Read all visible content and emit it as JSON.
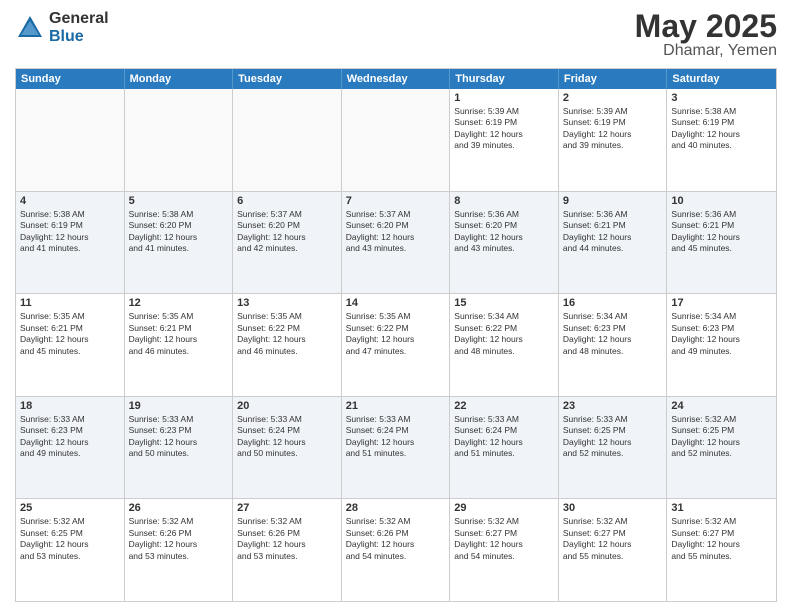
{
  "logo": {
    "general": "General",
    "blue": "Blue"
  },
  "title": "May 2025",
  "location": "Dhamar, Yemen",
  "weekdays": [
    "Sunday",
    "Monday",
    "Tuesday",
    "Wednesday",
    "Thursday",
    "Friday",
    "Saturday"
  ],
  "rows": [
    [
      {
        "day": "",
        "info": "",
        "empty": true
      },
      {
        "day": "",
        "info": "",
        "empty": true
      },
      {
        "day": "",
        "info": "",
        "empty": true
      },
      {
        "day": "",
        "info": "",
        "empty": true
      },
      {
        "day": "1",
        "info": "Sunrise: 5:39 AM\nSunset: 6:19 PM\nDaylight: 12 hours\nand 39 minutes."
      },
      {
        "day": "2",
        "info": "Sunrise: 5:39 AM\nSunset: 6:19 PM\nDaylight: 12 hours\nand 39 minutes."
      },
      {
        "day": "3",
        "info": "Sunrise: 5:38 AM\nSunset: 6:19 PM\nDaylight: 12 hours\nand 40 minutes."
      }
    ],
    [
      {
        "day": "4",
        "info": "Sunrise: 5:38 AM\nSunset: 6:19 PM\nDaylight: 12 hours\nand 41 minutes."
      },
      {
        "day": "5",
        "info": "Sunrise: 5:38 AM\nSunset: 6:20 PM\nDaylight: 12 hours\nand 41 minutes."
      },
      {
        "day": "6",
        "info": "Sunrise: 5:37 AM\nSunset: 6:20 PM\nDaylight: 12 hours\nand 42 minutes."
      },
      {
        "day": "7",
        "info": "Sunrise: 5:37 AM\nSunset: 6:20 PM\nDaylight: 12 hours\nand 43 minutes."
      },
      {
        "day": "8",
        "info": "Sunrise: 5:36 AM\nSunset: 6:20 PM\nDaylight: 12 hours\nand 43 minutes."
      },
      {
        "day": "9",
        "info": "Sunrise: 5:36 AM\nSunset: 6:21 PM\nDaylight: 12 hours\nand 44 minutes."
      },
      {
        "day": "10",
        "info": "Sunrise: 5:36 AM\nSunset: 6:21 PM\nDaylight: 12 hours\nand 45 minutes."
      }
    ],
    [
      {
        "day": "11",
        "info": "Sunrise: 5:35 AM\nSunset: 6:21 PM\nDaylight: 12 hours\nand 45 minutes."
      },
      {
        "day": "12",
        "info": "Sunrise: 5:35 AM\nSunset: 6:21 PM\nDaylight: 12 hours\nand 46 minutes."
      },
      {
        "day": "13",
        "info": "Sunrise: 5:35 AM\nSunset: 6:22 PM\nDaylight: 12 hours\nand 46 minutes."
      },
      {
        "day": "14",
        "info": "Sunrise: 5:35 AM\nSunset: 6:22 PM\nDaylight: 12 hours\nand 47 minutes."
      },
      {
        "day": "15",
        "info": "Sunrise: 5:34 AM\nSunset: 6:22 PM\nDaylight: 12 hours\nand 48 minutes."
      },
      {
        "day": "16",
        "info": "Sunrise: 5:34 AM\nSunset: 6:23 PM\nDaylight: 12 hours\nand 48 minutes."
      },
      {
        "day": "17",
        "info": "Sunrise: 5:34 AM\nSunset: 6:23 PM\nDaylight: 12 hours\nand 49 minutes."
      }
    ],
    [
      {
        "day": "18",
        "info": "Sunrise: 5:33 AM\nSunset: 6:23 PM\nDaylight: 12 hours\nand 49 minutes."
      },
      {
        "day": "19",
        "info": "Sunrise: 5:33 AM\nSunset: 6:23 PM\nDaylight: 12 hours\nand 50 minutes."
      },
      {
        "day": "20",
        "info": "Sunrise: 5:33 AM\nSunset: 6:24 PM\nDaylight: 12 hours\nand 50 minutes."
      },
      {
        "day": "21",
        "info": "Sunrise: 5:33 AM\nSunset: 6:24 PM\nDaylight: 12 hours\nand 51 minutes."
      },
      {
        "day": "22",
        "info": "Sunrise: 5:33 AM\nSunset: 6:24 PM\nDaylight: 12 hours\nand 51 minutes."
      },
      {
        "day": "23",
        "info": "Sunrise: 5:33 AM\nSunset: 6:25 PM\nDaylight: 12 hours\nand 52 minutes."
      },
      {
        "day": "24",
        "info": "Sunrise: 5:32 AM\nSunset: 6:25 PM\nDaylight: 12 hours\nand 52 minutes."
      }
    ],
    [
      {
        "day": "25",
        "info": "Sunrise: 5:32 AM\nSunset: 6:25 PM\nDaylight: 12 hours\nand 53 minutes."
      },
      {
        "day": "26",
        "info": "Sunrise: 5:32 AM\nSunset: 6:26 PM\nDaylight: 12 hours\nand 53 minutes."
      },
      {
        "day": "27",
        "info": "Sunrise: 5:32 AM\nSunset: 6:26 PM\nDaylight: 12 hours\nand 53 minutes."
      },
      {
        "day": "28",
        "info": "Sunrise: 5:32 AM\nSunset: 6:26 PM\nDaylight: 12 hours\nand 54 minutes."
      },
      {
        "day": "29",
        "info": "Sunrise: 5:32 AM\nSunset: 6:27 PM\nDaylight: 12 hours\nand 54 minutes."
      },
      {
        "day": "30",
        "info": "Sunrise: 5:32 AM\nSunset: 6:27 PM\nDaylight: 12 hours\nand 55 minutes."
      },
      {
        "day": "31",
        "info": "Sunrise: 5:32 AM\nSunset: 6:27 PM\nDaylight: 12 hours\nand 55 minutes."
      }
    ]
  ]
}
